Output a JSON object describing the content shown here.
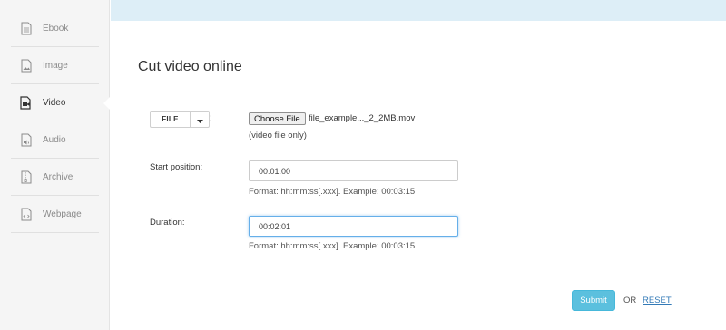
{
  "sidebar": {
    "items": [
      {
        "label": "Ebook",
        "icon": "document-icon"
      },
      {
        "label": "Image",
        "icon": "image-icon"
      },
      {
        "label": "Video",
        "icon": "video-icon"
      },
      {
        "label": "Audio",
        "icon": "audio-icon"
      },
      {
        "label": "Archive",
        "icon": "archive-icon"
      },
      {
        "label": "Webpage",
        "icon": "code-icon"
      }
    ],
    "active": "Video"
  },
  "main": {
    "title": "Cut video online",
    "file": {
      "button_label": "FILE",
      "colon": ":",
      "choose_label": "Choose File",
      "file_name": "file_example..._2_2MB.mov",
      "hint": "(video file only)"
    },
    "start": {
      "label": "Start position:",
      "value": "00:01:00",
      "format_hint": "Format: hh:mm:ss[.xxx]. Example: 00:03:15"
    },
    "duration": {
      "label": "Duration:",
      "value": "00:02:01",
      "format_hint": "Format: hh:mm:ss[.xxx]. Example: 00:03:15"
    },
    "actions": {
      "submit_label": "Submit",
      "or_label": "OR",
      "reset_label": "RESET"
    }
  },
  "colors": {
    "banner": "#ddeef7",
    "submit": "#5bc0de",
    "link": "#337ab7"
  }
}
